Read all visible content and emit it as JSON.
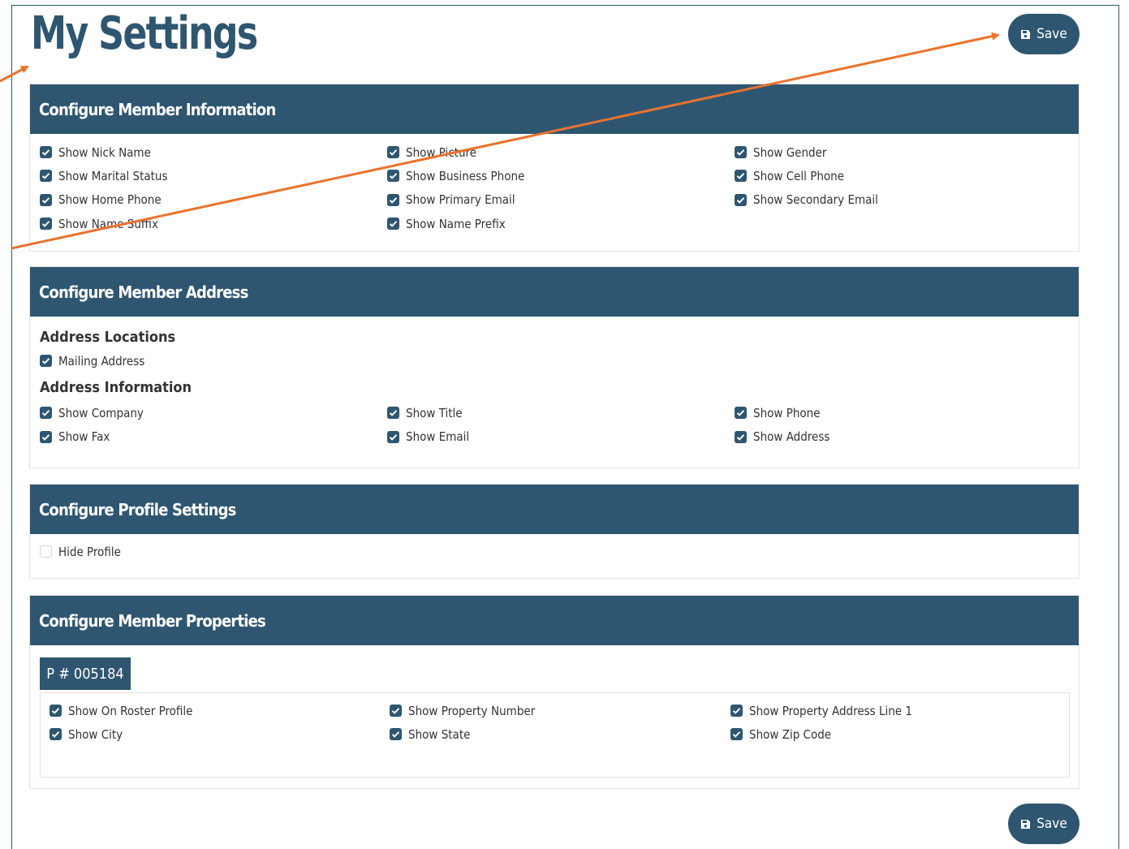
{
  "page": {
    "title": "My Settings",
    "save_label": "Save",
    "accent_color": "#2f5670",
    "annotation_color": "#e8732e"
  },
  "member_info": {
    "heading": "Configure Member Information",
    "options": [
      {
        "label": "Show Nick Name",
        "checked": true
      },
      {
        "label": "Show Picture",
        "checked": true
      },
      {
        "label": "Show Gender",
        "checked": true
      },
      {
        "label": "Show Marital Status",
        "checked": true
      },
      {
        "label": "Show Business Phone",
        "checked": true
      },
      {
        "label": "Show Cell Phone",
        "checked": true
      },
      {
        "label": "Show Home Phone",
        "checked": true
      },
      {
        "label": "Show Primary Email",
        "checked": true
      },
      {
        "label": "Show Secondary Email",
        "checked": true
      },
      {
        "label": "Show Name Suffix",
        "checked": true
      },
      {
        "label": "Show Name Prefix",
        "checked": true
      }
    ]
  },
  "member_address": {
    "heading": "Configure Member Address",
    "locations_title": "Address Locations",
    "locations": [
      {
        "label": "Mailing Address",
        "checked": true
      }
    ],
    "info_title": "Address Information",
    "options": [
      {
        "label": "Show Company",
        "checked": true
      },
      {
        "label": "Show Title",
        "checked": true
      },
      {
        "label": "Show Phone",
        "checked": true
      },
      {
        "label": "Show Fax",
        "checked": true
      },
      {
        "label": "Show Email",
        "checked": true
      },
      {
        "label": "Show Address",
        "checked": true
      }
    ]
  },
  "profile_settings": {
    "heading": "Configure Profile Settings",
    "options": [
      {
        "label": "Hide Profile",
        "checked": false
      }
    ]
  },
  "member_properties": {
    "heading": "Configure Member Properties",
    "property_tab": "P # 005184",
    "options": [
      {
        "label": "Show On Roster Profile",
        "checked": true
      },
      {
        "label": "Show Property Number",
        "checked": true
      },
      {
        "label": "Show Property Address Line 1",
        "checked": true
      },
      {
        "label": "Show City",
        "checked": true
      },
      {
        "label": "Show State",
        "checked": true
      },
      {
        "label": "Show Zip Code",
        "checked": true
      }
    ]
  }
}
